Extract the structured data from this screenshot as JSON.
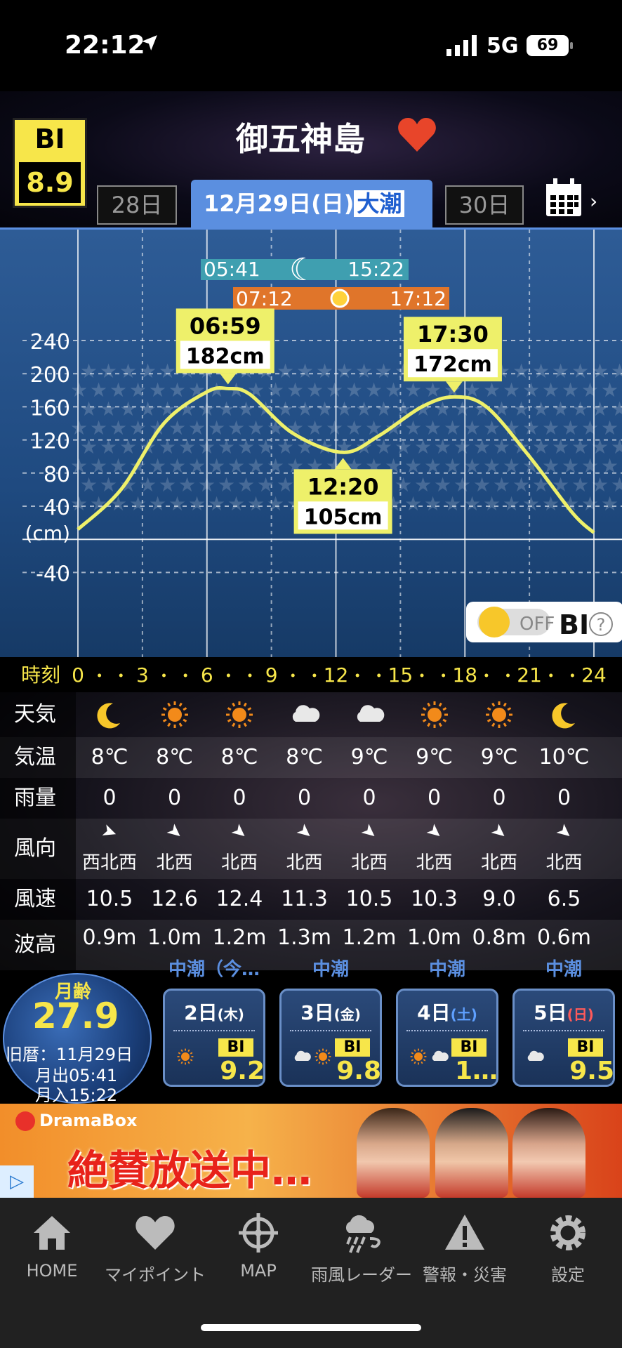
{
  "status": {
    "time": "22:12",
    "network": "5G",
    "battery": "69"
  },
  "header": {
    "bi_label": "BI",
    "bi_value": "8.9",
    "place": "御五神島",
    "heart_color": "#e8452a"
  },
  "datenav": {
    "prev": "28日",
    "current": "12月29日(日)",
    "tide_type": "大潮",
    "next": "30日"
  },
  "sun_moon": {
    "moonrise": "05:41",
    "moonset": "15:22",
    "sunrise": "07:12",
    "sunset": "17:12"
  },
  "chart_data": {
    "type": "line",
    "title": "",
    "xlabel": "時刻",
    "ylabel": "(cm)",
    "x_ticks": [
      "0",
      "3",
      "6",
      "9",
      "12",
      "15",
      "18",
      "21",
      "24"
    ],
    "y_ticks": [
      "240",
      "200",
      "160",
      "120",
      "80",
      "40",
      "-40"
    ],
    "ylim": [
      -60,
      270
    ],
    "xlim": [
      0,
      24
    ],
    "series": [
      {
        "x": [
          0,
          2,
          4,
          6,
          6.98,
          8,
          10,
          12.33,
          14,
          16,
          17.5,
          19,
          21,
          23,
          24
        ],
        "values": [
          12,
          60,
          140,
          178,
          182,
          175,
          128,
          105,
          125,
          160,
          172,
          160,
          100,
          32,
          8
        ]
      }
    ],
    "annotations": [
      {
        "time": "06:59",
        "height": "182cm"
      },
      {
        "time": "12:20",
        "height": "105cm"
      },
      {
        "time": "17:30",
        "height": "172cm"
      }
    ],
    "toggle_label": "OFF",
    "toggle_bi": "BI"
  },
  "time_axis": {
    "label": "時刻",
    "ticks": [
      "0",
      "3",
      "6",
      "9",
      "12",
      "15",
      "18",
      "21",
      "24"
    ]
  },
  "table": {
    "headers": [
      "天気",
      "気温",
      "雨量",
      "風向",
      "風速",
      "波高"
    ],
    "weather": [
      "moon",
      "sun",
      "sun",
      "cloud",
      "cloud",
      "sun",
      "sun",
      "moon"
    ],
    "temp": [
      "8℃",
      "8℃",
      "8℃",
      "8℃",
      "9℃",
      "9℃",
      "9℃",
      "10℃"
    ],
    "rain": [
      "0",
      "0",
      "0",
      "0",
      "0",
      "0",
      "0",
      "0"
    ],
    "wind_dir": [
      "西北西",
      "北西",
      "北西",
      "北西",
      "北西",
      "北西",
      "北西",
      "北西"
    ],
    "wind_speed": [
      "10.5",
      "12.6",
      "12.4",
      "11.3",
      "10.5",
      "10.3",
      "9.0",
      "6.5"
    ],
    "wave": [
      "0.9m",
      "1.0m",
      "1.2m",
      "1.3m",
      "1.2m",
      "1.0m",
      "0.8m",
      "0.6m"
    ]
  },
  "moon": {
    "label": "月齢",
    "age": "27.9",
    "lunar": "旧暦：11月29日",
    "rise": "月出05:41",
    "set": "月入15:22"
  },
  "days": [
    {
      "head": "中潮（今…",
      "date": "2日",
      "dow": "(木)",
      "bi": "9.2",
      "weather": "sun"
    },
    {
      "head": "中潮",
      "date": "3日",
      "dow": "(金)",
      "bi": "9.8",
      "weather": "cloud-sun"
    },
    {
      "head": "中潮",
      "date": "4日",
      "dow": "(土)",
      "bi": "1…",
      "weather": "sun-cloud"
    },
    {
      "head": "中潮",
      "date": "5日",
      "dow": "(日)",
      "bi": "9.5",
      "weather": "cloud"
    }
  ],
  "ad": {
    "brand": "DramaBox",
    "title": "絶賛放送中…",
    "badge": "▷"
  },
  "nav": [
    {
      "label": "HOME",
      "icon": "home-icon"
    },
    {
      "label": "マイポイント",
      "icon": "heart-icon"
    },
    {
      "label": "MAP",
      "icon": "crosshair-icon"
    },
    {
      "label": "雨風レーダー",
      "icon": "rain-wind-icon"
    },
    {
      "label": "警報・災害",
      "icon": "warning-icon"
    },
    {
      "label": "設定",
      "icon": "gear-icon"
    }
  ]
}
